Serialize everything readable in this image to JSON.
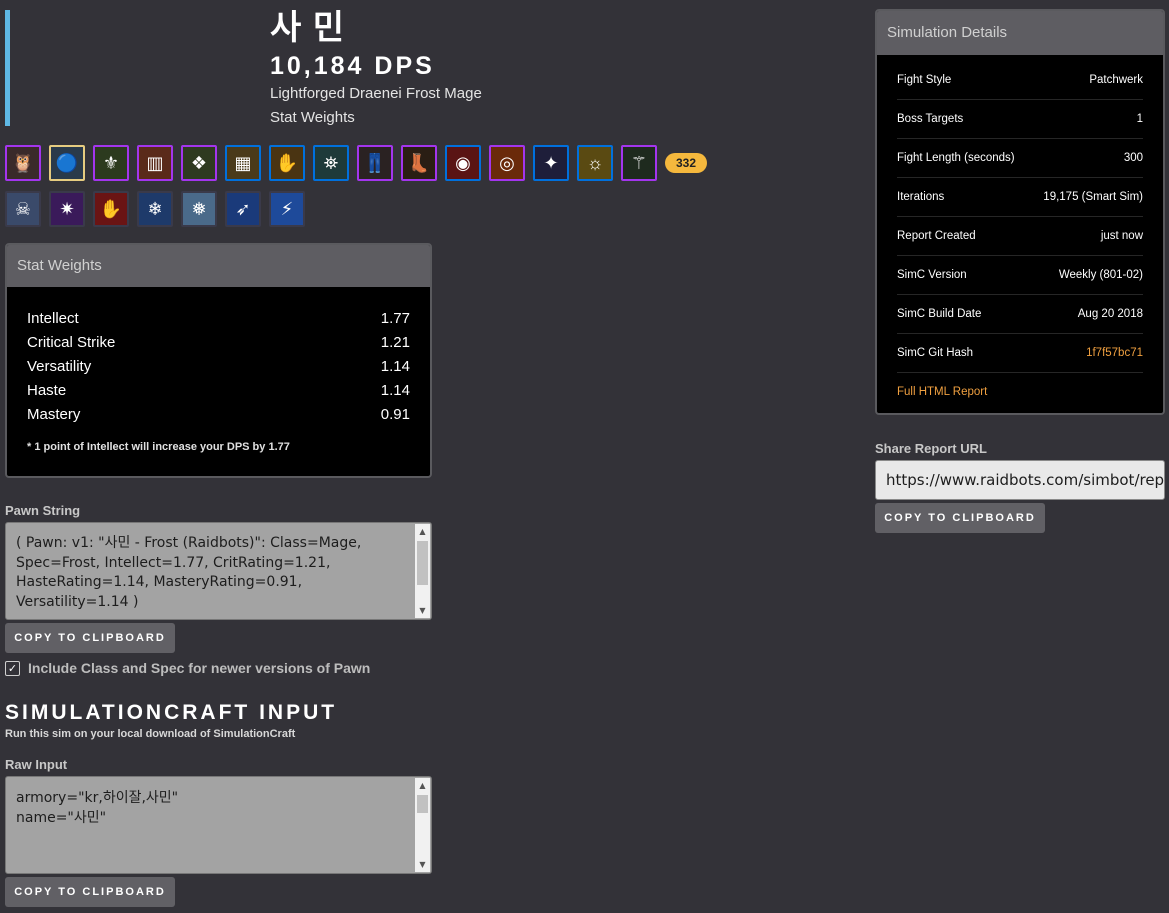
{
  "header": {
    "name": "사 민",
    "dps": "10,184 DPS",
    "race_spec": "Lightforged Draenei Frost Mage",
    "mode": "Stat Weights"
  },
  "gear": {
    "ilvl_badge": "332",
    "icons_row1": [
      {
        "name": "helm-icon",
        "glyph": "🦉",
        "bg": "#3a2a2a",
        "border": "#a335ee"
      },
      {
        "name": "neck-icon",
        "glyph": "🔵",
        "bg": "#2a3a4a",
        "border": "#e6cc80"
      },
      {
        "name": "shoulders-icon",
        "glyph": "⚜",
        "bg": "#2c3a1e",
        "border": "#a335ee"
      },
      {
        "name": "cloak-icon",
        "glyph": "▥",
        "bg": "#5a2a1a",
        "border": "#a335ee"
      },
      {
        "name": "chest-icon",
        "glyph": "❖",
        "bg": "#2e3a20",
        "border": "#a335ee"
      },
      {
        "name": "wrist-icon",
        "glyph": "▦",
        "bg": "#4a3a1a",
        "border": "#0070dd"
      },
      {
        "name": "gloves-icon",
        "glyph": "✋",
        "bg": "#4a3412",
        "border": "#0070dd"
      },
      {
        "name": "belt-icon",
        "glyph": "⛯",
        "bg": "#1e3a3a",
        "border": "#0070dd"
      },
      {
        "name": "legs-icon",
        "glyph": "👖",
        "bg": "#2a2222",
        "border": "#a335ee"
      },
      {
        "name": "boots-icon",
        "glyph": "👢",
        "bg": "#2a1e14",
        "border": "#a335ee"
      },
      {
        "name": "ring1-icon",
        "glyph": "◉",
        "bg": "#5a1414",
        "border": "#0070dd"
      },
      {
        "name": "ring2-icon",
        "glyph": "◎",
        "bg": "#6a2a0a",
        "border": "#a335ee"
      },
      {
        "name": "trinket1-icon",
        "glyph": "✦",
        "bg": "#1e1e3a",
        "border": "#0070dd"
      },
      {
        "name": "trinket2-icon",
        "glyph": "☼",
        "bg": "#5a4a12",
        "border": "#0070dd"
      },
      {
        "name": "weapon-icon",
        "glyph": "⚚",
        "bg": "#1e2a1e",
        "border": "#a335ee"
      }
    ],
    "icons_row2": [
      {
        "name": "skull-talent-icon",
        "glyph": "☠",
        "bg": "#3a4a6a",
        "border": "#3a3a4a"
      },
      {
        "name": "arcane-talent-icon",
        "glyph": "✷",
        "bg": "#3a1a5a",
        "border": "#3a3a4a"
      },
      {
        "name": "hand-talent-icon",
        "glyph": "✋",
        "bg": "#6a1414",
        "border": "#3a3a4a"
      },
      {
        "name": "ice-shard-talent-icon",
        "glyph": "❄",
        "bg": "#1e3a6a",
        "border": "#3a3a4a"
      },
      {
        "name": "frost-nova-talent-icon",
        "glyph": "❅",
        "bg": "#4a6a8a",
        "border": "#3a3a4a"
      },
      {
        "name": "ice-lance-talent-icon",
        "glyph": "➶",
        "bg": "#1a3a7a",
        "border": "#3a3a4a"
      },
      {
        "name": "glacial-spike-talent-icon",
        "glyph": "⚡",
        "bg": "#1e4a9a",
        "border": "#3a3a4a"
      }
    ]
  },
  "stat_weights": {
    "heading": "Stat Weights",
    "rows": [
      {
        "stat": "Intellect",
        "value": "1.77"
      },
      {
        "stat": "Critical Strike",
        "value": "1.21"
      },
      {
        "stat": "Versatility",
        "value": "1.14"
      },
      {
        "stat": "Haste",
        "value": "1.14"
      },
      {
        "stat": "Mastery",
        "value": "0.91"
      }
    ],
    "note": "* 1 point of Intellect will increase your DPS by 1.77"
  },
  "pawn": {
    "label": "Pawn String",
    "value": "( Pawn: v1: \"사민 - Frost (Raidbots)\": Class=Mage, Spec=Frost, Intellect=1.77, CritRating=1.21, HasteRating=1.14, MasteryRating=0.91, Versatility=1.14 )",
    "copy_label": "COPY TO CLIPBOARD",
    "checkbox_label": "Include Class and Spec for newer versions of Pawn",
    "checkbox_checked": true
  },
  "simc_input": {
    "title": "SIMULATIONCRAFT INPUT",
    "subtitle": "Run this sim on your local download of SimulationCraft",
    "raw_label": "Raw Input",
    "raw_line1": "armory=\"kr,하이잘,사민\"",
    "raw_line2": "name=\"사민\"",
    "copy_label": "COPY TO CLIPBOARD"
  },
  "sim_details": {
    "heading": "Simulation Details",
    "rows": [
      {
        "label": "Fight Style",
        "value": "Patchwerk"
      },
      {
        "label": "Boss Targets",
        "value": "1"
      },
      {
        "label": "Fight Length (seconds)",
        "value": "300"
      },
      {
        "label": "Iterations",
        "value": "19,175 (Smart Sim)"
      },
      {
        "label": "Report Created",
        "value": "just now"
      },
      {
        "label": "SimC Version",
        "value": "Weekly (801-02)"
      },
      {
        "label": "SimC Build Date",
        "value": "Aug 20 2018"
      },
      {
        "label": "SimC Git Hash",
        "value": "1f7f57bc71"
      }
    ],
    "full_report_link": "Full HTML Report"
  },
  "share": {
    "label": "Share Report URL",
    "url": "https://www.raidbots.com/simbot/report",
    "copy_label": "COPY TO CLIPBOARD"
  },
  "colors": {
    "accent_bar": "#5fb8e5",
    "badge": "#f5b83d",
    "link": "#f0a040"
  }
}
